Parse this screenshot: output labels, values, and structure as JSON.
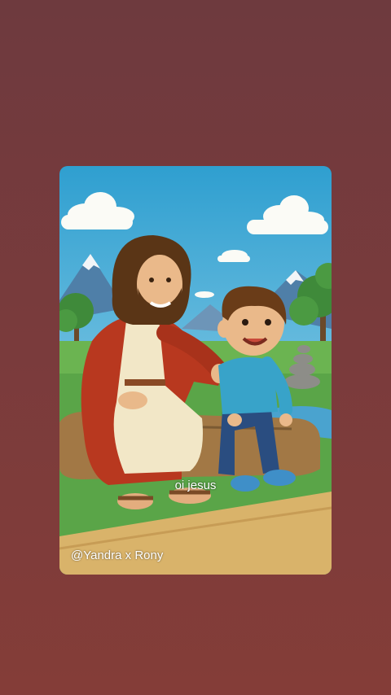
{
  "caption": "oi jesus",
  "watermark": "@Yandra x Rony",
  "colors": {
    "background_top": "#6e3a3e",
    "background_bottom": "#843d38",
    "sky": "#4fb6d9",
    "grass": "#5aa548",
    "path": "#d9b36a"
  }
}
